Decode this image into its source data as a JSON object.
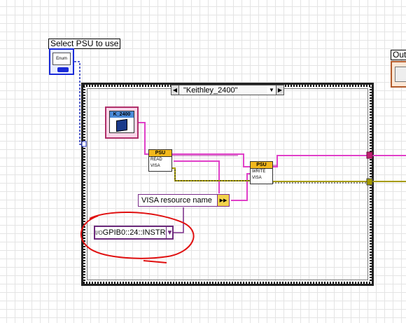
{
  "control": {
    "label": "Select PSU to use",
    "value": "Enum"
  },
  "output_label": "Out",
  "case_structure": {
    "selector_value": "\"Keithley_2400\"",
    "left_arrow": "◀",
    "right_arrow": "▶",
    "dropdown": "▼"
  },
  "constant_block": {
    "label": "K_2400"
  },
  "read_subvi": {
    "header": "PSU",
    "line1": "READ",
    "line2": "VISA"
  },
  "write_subvi": {
    "header": "PSU",
    "line1": "WRITE",
    "line2": "VISA"
  },
  "visa_resource": {
    "label": "VISA resource name",
    "term": "▶▶"
  },
  "gpib_constant": {
    "io_glyph": "I/O",
    "value": "GPIB0::24::INSTR",
    "dropdown": "▼"
  },
  "colors": {
    "wire_pink": "#e040c8",
    "wire_yellow": "#a59b00",
    "wire_purple": "#7a2d8a",
    "annotation": "#e01010",
    "blue_wire": "#2030c0"
  }
}
